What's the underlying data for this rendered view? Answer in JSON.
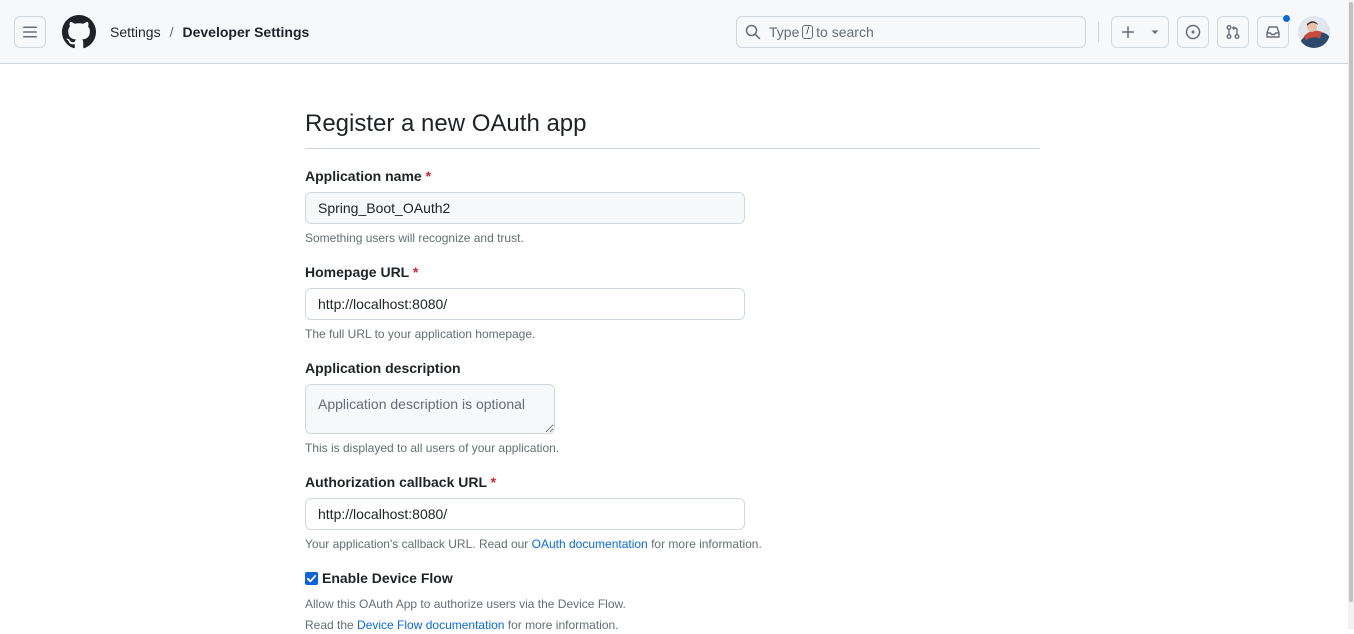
{
  "header": {
    "breadcrumb": {
      "settings": "Settings",
      "separator": "/",
      "current": "Developer Settings"
    },
    "search": {
      "prefix": "Type",
      "key": "/",
      "suffix": "to search"
    },
    "icons": [
      "menu-icon",
      "github-logo-icon",
      "search-icon",
      "plus-icon",
      "triangle-down-icon",
      "issue-icon",
      "pull-request-icon",
      "inbox-icon"
    ],
    "notification_dot_color": "#0969da"
  },
  "form": {
    "title": "Register a new OAuth app",
    "required_mark": "*",
    "app_name": {
      "label": "Application name",
      "value": "Spring_Boot_OAuth2",
      "note": "Something users will recognize and trust."
    },
    "homepage": {
      "label": "Homepage URL",
      "value": "http://localhost:8080/",
      "note": "The full URL to your application homepage."
    },
    "description": {
      "label": "Application description",
      "placeholder": "Application description is optional",
      "note": "This is displayed to all users of your application."
    },
    "callback": {
      "label": "Authorization callback URL",
      "value": "http://localhost:8080/",
      "note_prefix": "Your application's callback URL. Read our",
      "note_link": "OAuth documentation",
      "note_suffix": "for more information."
    },
    "device_flow": {
      "label": "Enable Device Flow",
      "checked": true,
      "note": "Allow this OAuth App to authorize users via the Device Flow.",
      "note2_prefix": "Read the",
      "note2_link": "Device Flow documentation",
      "note2_suffix": "for more information."
    }
  },
  "colors": {
    "accent": "#0969da",
    "required": "#d1242f",
    "checkbox": "#0b63d8"
  }
}
